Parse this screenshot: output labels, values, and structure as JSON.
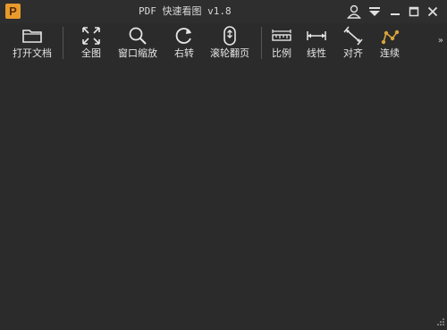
{
  "window": {
    "title": "PDF 快速看图 v1.8",
    "logo_letter": "P",
    "controls": [
      {
        "name": "user-icon"
      },
      {
        "name": "menu-dropdown-icon"
      },
      {
        "name": "minimize-icon"
      },
      {
        "name": "maximize-icon"
      },
      {
        "name": "close-icon"
      }
    ]
  },
  "toolbar": {
    "items": [
      {
        "label": "打开文档",
        "icon": "folder-icon"
      },
      {
        "label": "全图",
        "icon": "fit-all-icon"
      },
      {
        "label": "窗口缩放",
        "icon": "zoom-window-icon"
      },
      {
        "label": "右转",
        "icon": "rotate-right-icon"
      },
      {
        "label": "滚轮翻页",
        "icon": "mouse-wheel-icon"
      },
      {
        "label": "比例",
        "icon": "scale-ruler-icon"
      },
      {
        "label": "线性",
        "icon": "linear-measure-icon"
      },
      {
        "label": "对齐",
        "icon": "align-measure-icon"
      },
      {
        "label": "连续",
        "icon": "continuous-measure-icon"
      }
    ],
    "overflow": "»"
  },
  "colors": {
    "background": "#2b2b2b",
    "accent": "#e89a2c",
    "continuous_icon": "#d9a53a"
  }
}
